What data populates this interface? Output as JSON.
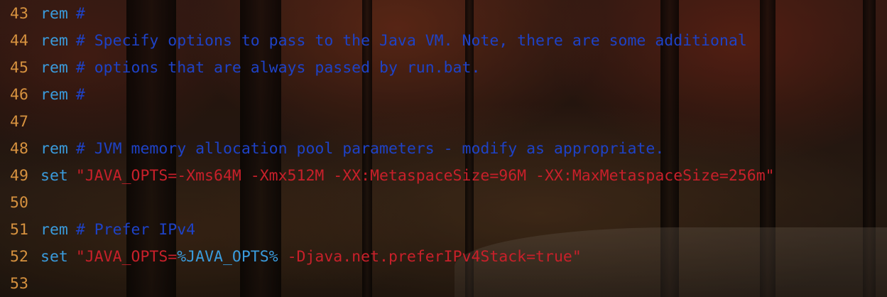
{
  "colors": {
    "line_number": "#d7923f",
    "keyword": "#3a9bdc",
    "comment": "#1e42c6",
    "string": "#c8202a",
    "variable": "#3a9bdc"
  },
  "lines": [
    {
      "n": "43",
      "kw": "rem",
      "comment": "#"
    },
    {
      "n": "44",
      "kw": "rem",
      "comment": "# Specify options to pass to the Java VM. Note, there are some additional"
    },
    {
      "n": "45",
      "kw": "rem",
      "comment": "# options that are always passed by run.bat."
    },
    {
      "n": "46",
      "kw": "rem",
      "comment": "#"
    },
    {
      "n": "47"
    },
    {
      "n": "48",
      "kw": "rem",
      "comment": "# JVM memory allocation pool parameters - modify as appropriate."
    },
    {
      "n": "49",
      "kw": "set",
      "str": "\"JAVA_OPTS=-Xms64M -Xmx512M -XX:MetaspaceSize=96M -XX:MaxMetaspaceSize=256m\""
    },
    {
      "n": "50"
    },
    {
      "n": "51",
      "kw": "rem",
      "comment": "# Prefer IPv4"
    },
    {
      "n": "52",
      "kw": "set",
      "str_a": "\"JAVA_OPTS=",
      "var": "%JAVA_OPTS%",
      "str_b": " -Djava.net.preferIPv4Stack=true\""
    },
    {
      "n": "53"
    }
  ]
}
